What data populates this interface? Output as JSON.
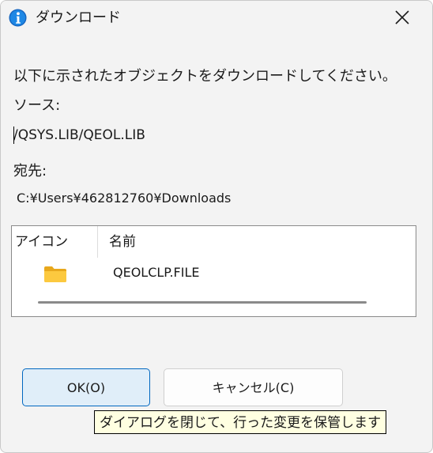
{
  "window": {
    "title": "ダウンロード",
    "app_icon": "info-i-icon",
    "close_icon": "close-icon",
    "accent_color": "#0067c0"
  },
  "message": "以下に示されたオブジェクトをダウンロードしてください。",
  "source": {
    "label": "ソース:",
    "value": "/QSYS.LIB/QEOL.LIB"
  },
  "destination": {
    "label": "宛先:",
    "value": "C:¥Users¥462812760¥Downloads"
  },
  "file_list": {
    "columns": [
      "アイコン",
      "名前"
    ],
    "rows": [
      {
        "icon": "folder-icon",
        "name": "QEOLCLP.FILE"
      }
    ]
  },
  "buttons": {
    "ok": "OK(O)",
    "cancel": "キャンセル(C)"
  },
  "tooltip": "ダイアログを閉じて、行った変更を保管します"
}
